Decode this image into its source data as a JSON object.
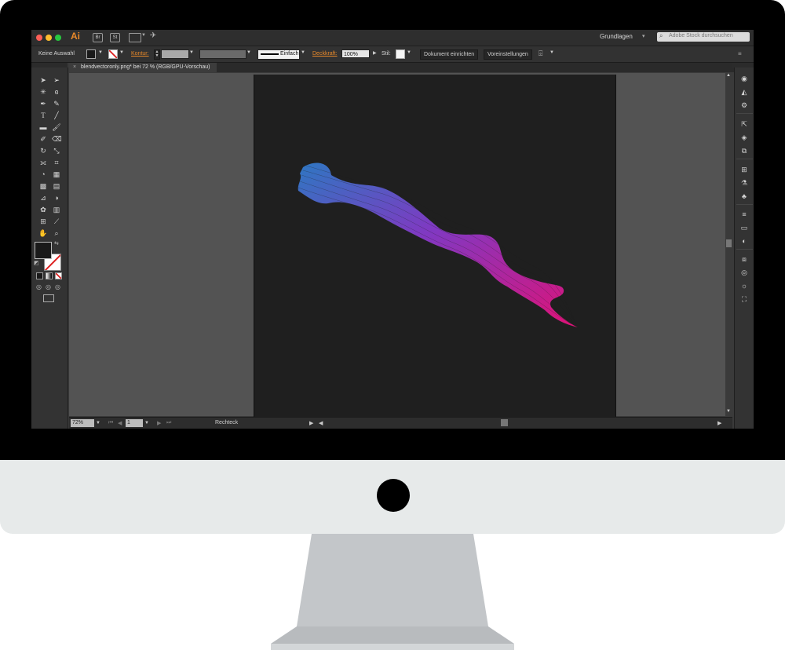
{
  "app": {
    "logo": "Ai",
    "titlebar_icons": [
      "Br",
      "St"
    ],
    "workspace_label": "Grundlagen",
    "stock_search_placeholder": "Adobe Stock durchsuchen"
  },
  "controlbar": {
    "selection_label": "Keine Auswahl",
    "stroke_label": "Kontur:",
    "stroke_profile": "Einfach",
    "opacity_label": "Deckkraft:",
    "opacity_value": "100%",
    "style_label": "Stil:",
    "document_setup_button": "Dokument einrichten",
    "preferences_button": "Voreinstellungen"
  },
  "document": {
    "tab_title": "blendvectoronly.png* bei 72 % (RGB/GPU-Vorschau)"
  },
  "statusbar": {
    "zoom": "72%",
    "artboard_number": "1",
    "current_tool": "Rechteck"
  },
  "colors": {
    "accent_orange": "#e8892a",
    "artwork_gradient_start": "#2f7fd0",
    "artwork_gradient_mid": "#8a3ad0",
    "artwork_gradient_end": "#f0117e",
    "fill_swatch": "#1a1a1a"
  },
  "icons": {
    "tools": [
      "selection-icon",
      "direct-selection-icon",
      "magic-wand-icon",
      "lasso-icon",
      "pen-icon",
      "curvature-icon",
      "type-icon",
      "line-icon",
      "rectangle-icon",
      "paintbrush-icon",
      "shaper-icon",
      "eraser-icon",
      "rotate-icon",
      "scale-icon",
      "width-icon",
      "free-transform-icon",
      "shape-builder-icon",
      "perspective-icon",
      "mesh-icon",
      "gradient-icon",
      "eyedropper-icon",
      "blend-icon",
      "symbol-sprayer-icon",
      "column-graph-icon",
      "artboard-icon",
      "slice-icon",
      "hand-icon",
      "zoom-icon"
    ],
    "right_panel": [
      "color-icon",
      "color-guide-icon",
      "appearance-icon",
      "export-icon",
      "layers-icon",
      "artboards-icon",
      "transform-icon",
      "properties-icon",
      "symbols-icon",
      "stroke-icon",
      "gradient-panel-icon",
      "transparency-icon",
      "align-icon",
      "pathfinder-icon",
      "graphic-styles-icon",
      "brushes-icon",
      "links-icon"
    ]
  }
}
